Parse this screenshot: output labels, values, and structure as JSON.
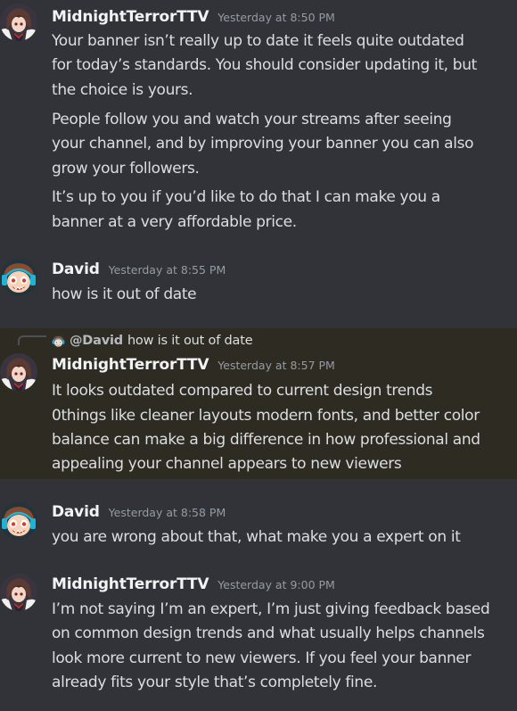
{
  "users": {
    "midnight": {
      "name": "MidnightTerrorTTV"
    },
    "david": {
      "name": "David"
    }
  },
  "messages": [
    {
      "author": "MidnightTerrorTTV",
      "timestamp": "Yesterday at 8:50 PM",
      "lines": [
        "Your banner isn’t really up to date it feels quite outdated",
        "for today’s standards. You should consider updating it, but",
        "the choice is yours.",
        "People follow you and watch your streams after seeing",
        "your channel, and by improving your banner you can also",
        "grow your followers.",
        "It’s up to you if you’d like to do that I can make you a",
        "banner at a very affordable price."
      ]
    },
    {
      "author": "David",
      "timestamp": "Yesterday at 8:55 PM",
      "lines": [
        "how is it out of date"
      ]
    },
    {
      "author": "MidnightTerrorTTV",
      "timestamp": "Yesterday at 8:57 PM",
      "reply": {
        "mention": "@David",
        "text": "how is it out of date"
      },
      "lines": [
        "It looks outdated compared to current design trends",
        "0things like cleaner layouts modern fonts, and better color",
        "balance can make a big difference in how professional and",
        "appealing your channel appears to new viewers"
      ]
    },
    {
      "author": "David",
      "timestamp": "Yesterday at 8:58 PM",
      "lines": [
        "you are wrong about that, what make you a  expert on it"
      ]
    },
    {
      "author": "MidnightTerrorTTV",
      "timestamp": "Yesterday at 9:00 PM",
      "lines": [
        "I’m not saying I’m an expert, I’m just giving feedback based",
        "on common design trends and what usually helps channels",
        "look more current to new viewers. If you feel your banner",
        "already fits your style that’s completely fine."
      ]
    }
  ],
  "colors": {
    "background": "#313338",
    "highlight": "#2e2b22",
    "username": "#f2f3f5",
    "timestamp": "#949ba4",
    "text": "#dbdee1"
  }
}
